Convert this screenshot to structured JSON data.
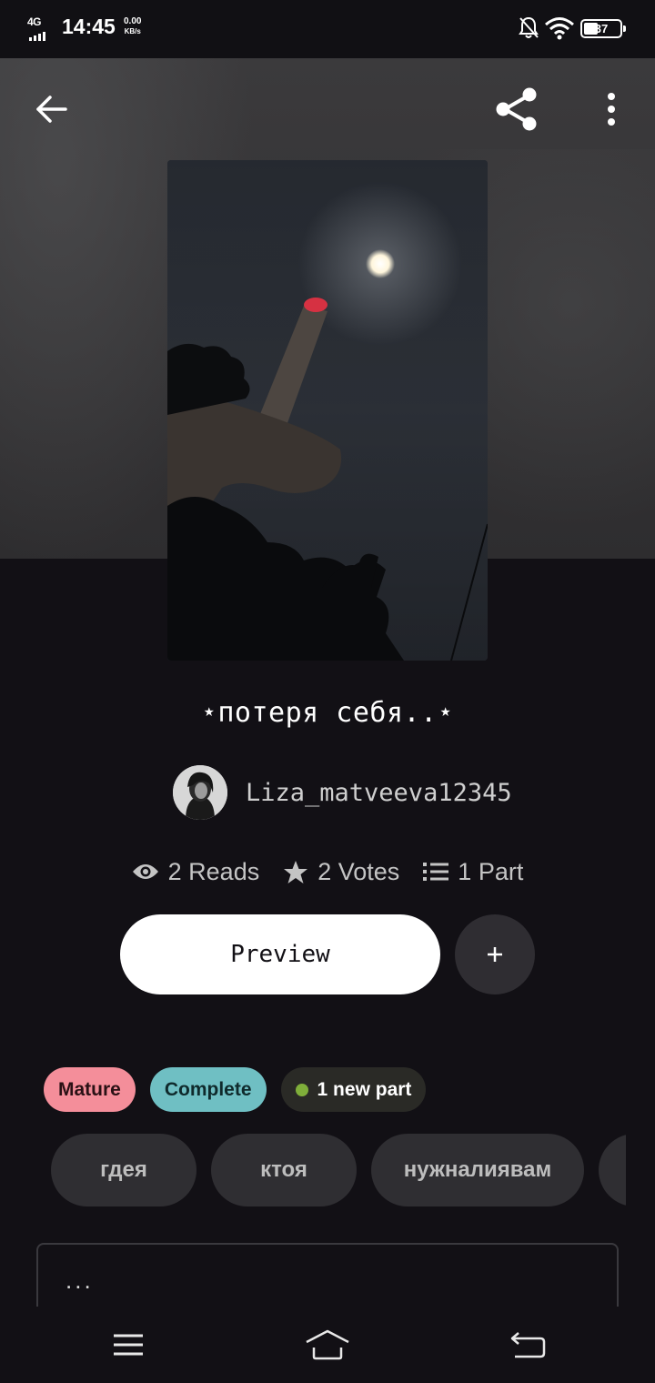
{
  "status_bar": {
    "network": "4G",
    "time": "14:45",
    "speed_value": "0.00",
    "speed_unit": "KB/s",
    "battery": "37"
  },
  "toolbar": {
    "back_icon": "arrow-left-icon",
    "share_icon": "share-icon",
    "more_icon": "more-vertical-icon"
  },
  "story": {
    "title": "⋆потеря себя..⋆",
    "author": "Liza_matveeva12345"
  },
  "stats": {
    "reads": "2 Reads",
    "votes": "2 Votes",
    "parts": "1 Part"
  },
  "actions": {
    "preview_label": "Preview",
    "add_label": "+"
  },
  "badges": {
    "mature": "Mature",
    "complete": "Complete",
    "new_part": "1 new part"
  },
  "tags": [
    "гдея",
    "ктоя",
    "нужналиявам",
    ""
  ],
  "description": {
    "text": "..."
  },
  "colors": {
    "background": "#121015",
    "mature": "#f48e9a",
    "complete": "#6fbfc3",
    "new_dot": "#7fae3a"
  }
}
